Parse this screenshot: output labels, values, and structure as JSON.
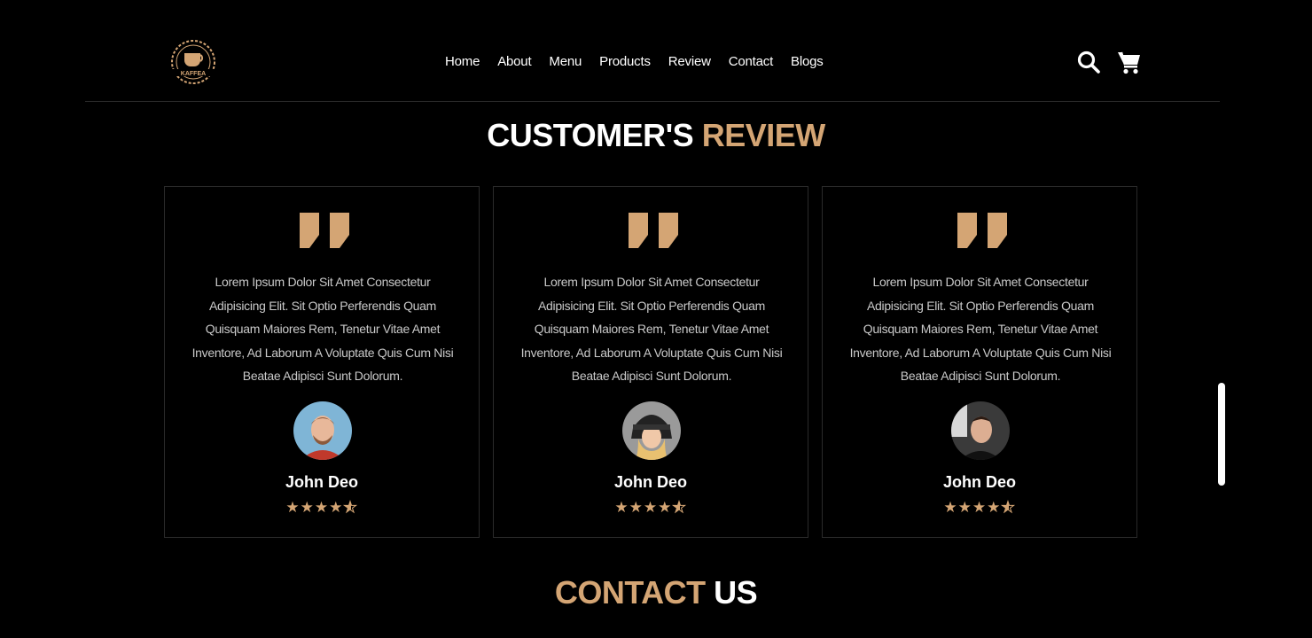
{
  "brand": {
    "logo_text": "KAFFEA",
    "accent_color": "#d4a574"
  },
  "nav": {
    "items": [
      {
        "label": "Home"
      },
      {
        "label": "About"
      },
      {
        "label": "Menu"
      },
      {
        "label": "Products"
      },
      {
        "label": "Review"
      },
      {
        "label": "Contact"
      },
      {
        "label": "Blogs"
      }
    ]
  },
  "header_icons": {
    "search": "search-icon",
    "cart": "cart-icon"
  },
  "review_section": {
    "title_part1": "CUSTOMER'S",
    "title_part2": "REVIEW"
  },
  "reviews": [
    {
      "text": "Lorem Ipsum Dolor Sit Amet Consectetur Adipisicing Elit. Sit Optio Perferendis Quam Quisquam Maiores Rem, Tenetur Vitae Amet Inventore, Ad Laborum A Voluptate Quis Cum Nisi Beatae Adipisci Sunt Dolorum.",
      "name": "John Deo",
      "rating": 4.5
    },
    {
      "text": "Lorem Ipsum Dolor Sit Amet Consectetur Adipisicing Elit. Sit Optio Perferendis Quam Quisquam Maiores Rem, Tenetur Vitae Amet Inventore, Ad Laborum A Voluptate Quis Cum Nisi Beatae Adipisci Sunt Dolorum.",
      "name": "John Deo",
      "rating": 4.5
    },
    {
      "text": "Lorem Ipsum Dolor Sit Amet Consectetur Adipisicing Elit. Sit Optio Perferendis Quam Quisquam Maiores Rem, Tenetur Vitae Amet Inventore, Ad Laborum A Voluptate Quis Cum Nisi Beatae Adipisci Sunt Dolorum.",
      "name": "John Deo",
      "rating": 4.5
    }
  ],
  "contact_section": {
    "title_part1": "CONTACT",
    "title_part2": "US"
  }
}
